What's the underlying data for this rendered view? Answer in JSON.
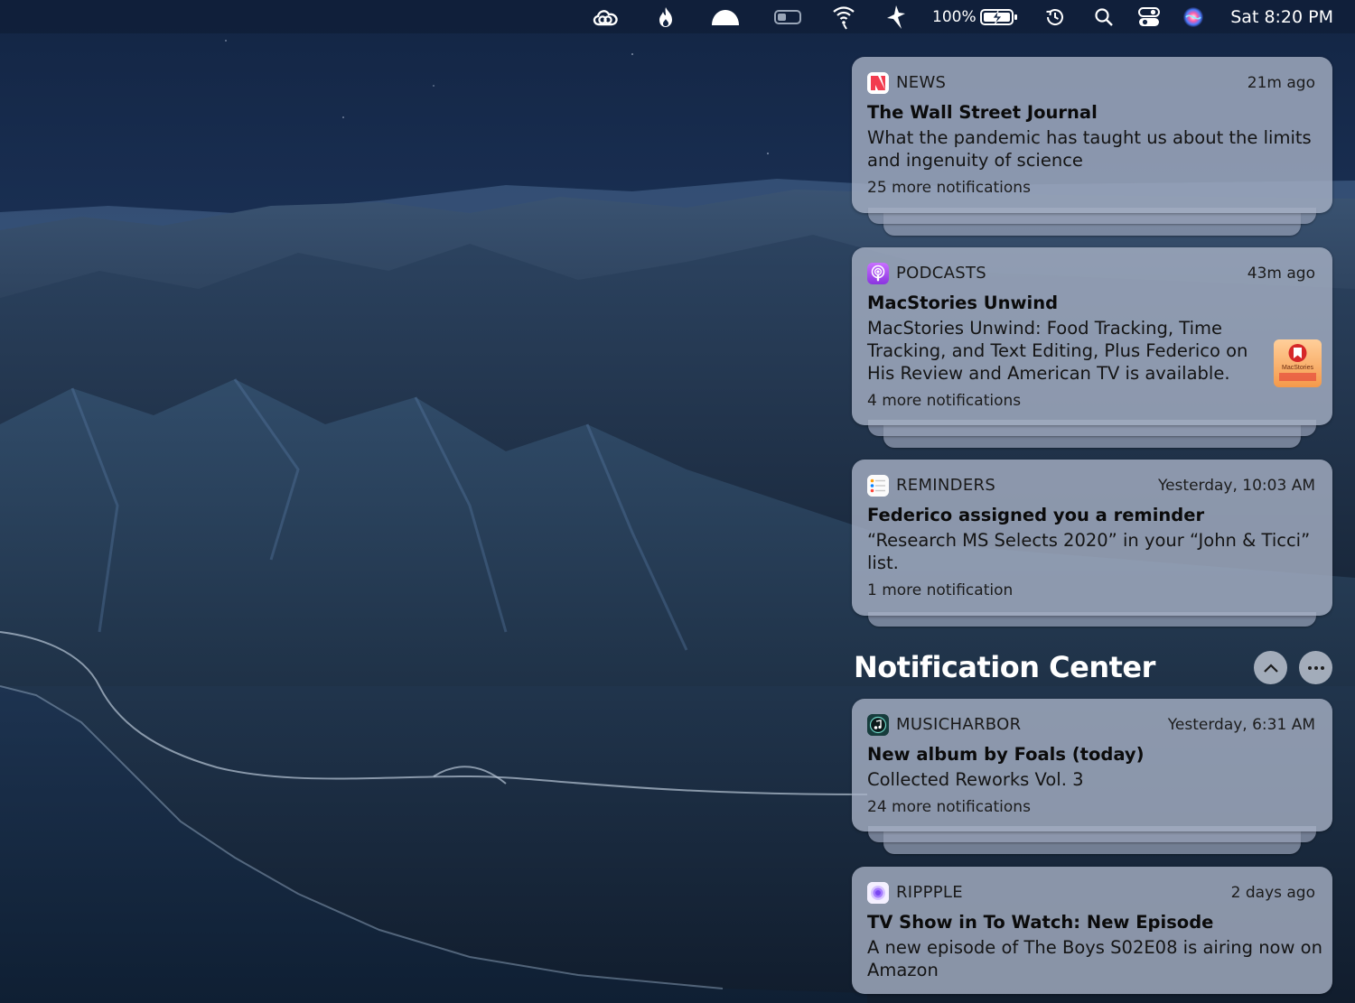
{
  "menubar": {
    "icons": [
      "creative-cloud-icon",
      "flame-icon",
      "cloud-icon",
      "toggle-icon",
      "wifi-icon",
      "bolt-icon",
      "battery-charging-icon",
      "time-machine-icon",
      "search-icon",
      "control-center-icon",
      "siri-icon"
    ],
    "battery_percent": "100%",
    "clock": "Sat 8:20 PM"
  },
  "notification_center": {
    "title": "Notification Center",
    "collapse_icon": "chevron-up-icon",
    "more_icon": "ellipsis-icon"
  },
  "notifications": [
    {
      "app": "NEWS",
      "icon": "news-icon",
      "time": "21m ago",
      "title": "The Wall Street Journal",
      "body_lines": [
        "What the pandemic has taught us about the limits",
        "and ingenuity of science"
      ],
      "more": "25 more notifications"
    },
    {
      "app": "PODCASTS",
      "icon": "podcasts-icon",
      "time": "43m ago",
      "title": "MacStories Unwind",
      "body_lines": [
        "MacStories Unwind: Food Tracking, Time",
        "Tracking, and Text Editing, Plus Federico on",
        "His Review and American TV is available."
      ],
      "more": "4 more notifications",
      "thumbnail_text": "MacStories"
    },
    {
      "app": "REMINDERS",
      "icon": "reminders-icon",
      "time": "Yesterday, 10:03 AM",
      "title": "Federico assigned you a reminder",
      "body_lines": [
        "“Research MS Selects 2020” in your “John & Ticci”",
        "list."
      ],
      "more": "1 more notification"
    },
    {
      "app": "MUSICHARBOR",
      "icon": "musicharbor-icon",
      "time": "Yesterday, 6:31 AM",
      "title": "New album by Foals (today)",
      "body_lines": [
        "Collected Reworks Vol. 3"
      ],
      "more": "24 more notifications"
    },
    {
      "app": "RIPPPLE",
      "icon": "ripple-icon",
      "time": "2 days ago",
      "title": "TV Show in To Watch: New Episode",
      "body_lines": [
        "A new episode of The Boys S02E08 is airing now on",
        "Amazon"
      ]
    }
  ],
  "colors": {
    "card_background": "#a8b2c6",
    "news_red": "#f23c4f",
    "podcasts_purple": "#a24ef0",
    "menubar": "#101e38"
  }
}
